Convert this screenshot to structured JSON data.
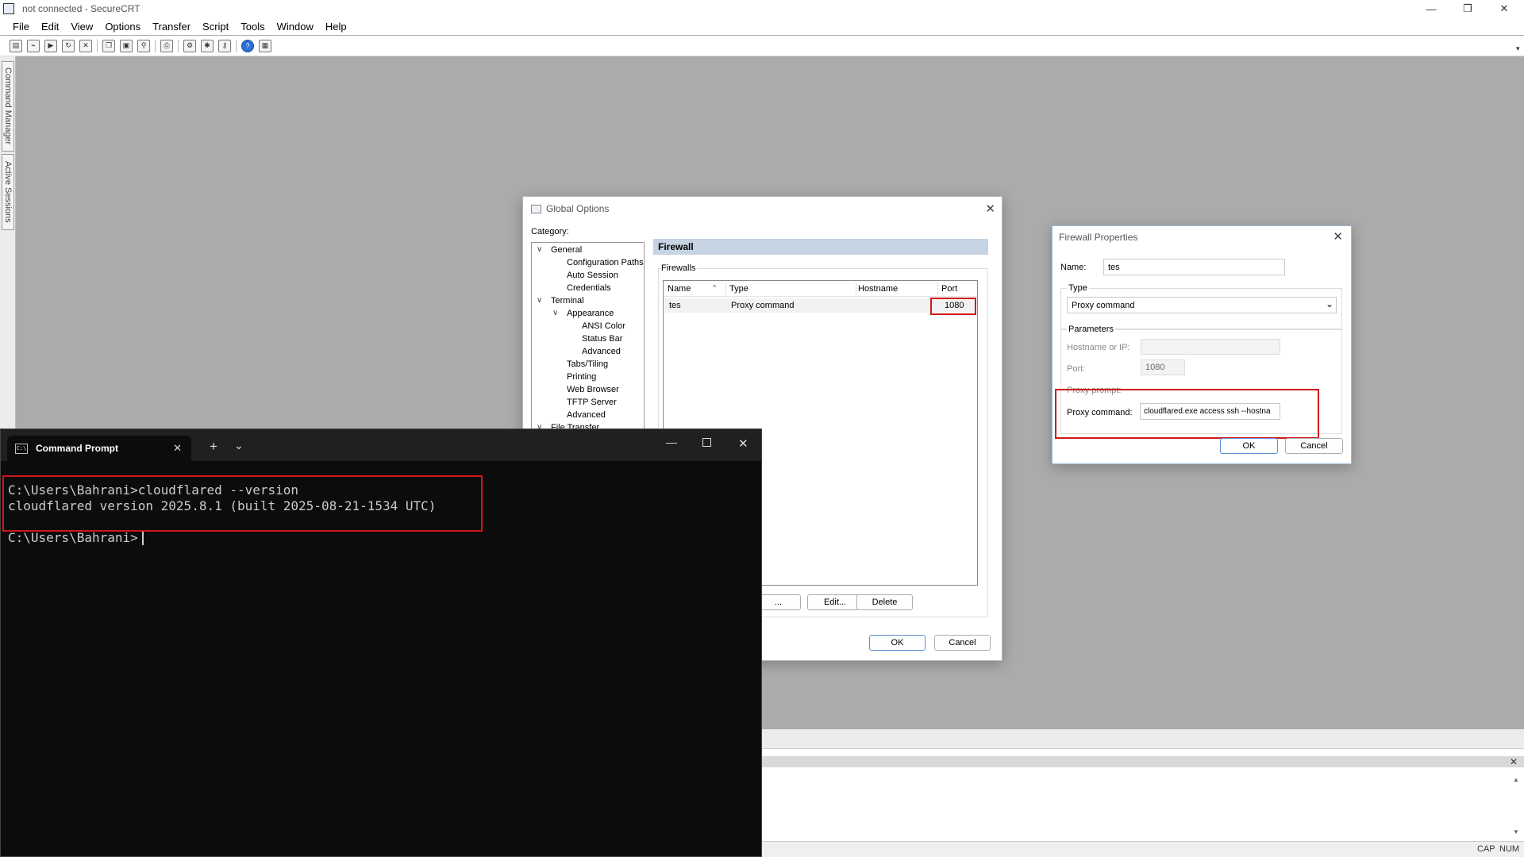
{
  "window": {
    "title": "not connected - SecureCRT",
    "controls": {
      "minimize": "—",
      "maximize": "❐",
      "close": "✕"
    }
  },
  "menu": [
    "File",
    "Edit",
    "View",
    "Options",
    "Transfer",
    "Script",
    "Tools",
    "Window",
    "Help"
  ],
  "side_tabs": [
    "Command Manager",
    "Active Sessions"
  ],
  "status_bar": {
    "cap": "CAP",
    "num": "NUM"
  },
  "global_options": {
    "title": "Global Options",
    "category_label": "Category:",
    "tree": {
      "general": "General",
      "configuration_paths": "Configuration Paths",
      "auto_session": "Auto Session",
      "credentials": "Credentials",
      "terminal": "Terminal",
      "appearance": "Appearance",
      "ansi_color": "ANSI Color",
      "status_bar": "Status Bar",
      "advanced_appearance": "Advanced",
      "tabs_tiling": "Tabs/Tiling",
      "printing": "Printing",
      "web_browser": "Web Browser",
      "tftp_server": "TFTP Server",
      "advanced_terminal": "Advanced",
      "file_transfer": "File Transfer"
    },
    "panel_title": "Firewall",
    "group_label": "Firewalls",
    "columns": {
      "name": "Name",
      "type": "Type",
      "hostname": "Hostname",
      "port": "Port"
    },
    "rows": [
      {
        "name": "tes",
        "type": "Proxy command",
        "hostname": "",
        "port": "1080"
      }
    ],
    "buttons": {
      "add": "...",
      "edit": "Edit...",
      "delete": "Delete",
      "ok": "OK",
      "cancel": "Cancel"
    }
  },
  "firewall_properties": {
    "title": "Firewall Properties",
    "name_label": "Name:",
    "name_value": "tes",
    "type_label": "Type",
    "type_value": "Proxy command",
    "parameters_label": "Parameters",
    "hostname_label": "Hostname or IP:",
    "hostname_value": "",
    "port_label": "Port:",
    "port_value": "1080",
    "proxy_prompt_label": "Proxy prompt:",
    "proxy_command_label": "Proxy command:",
    "proxy_command_value": "cloudflared.exe access ssh --hostna",
    "ok": "OK",
    "cancel": "Cancel"
  },
  "command_prompt": {
    "tab_title": "Command Prompt",
    "tab_icon": "C:\\",
    "new_tab": "+",
    "dropdown": "⌄",
    "lines": [
      "C:\\Users\\Bahrani>cloudflared --version",
      "cloudflared version 2025.8.1 (built 2025-08-21-1534 UTC)",
      "C:\\Users\\Bahrani>"
    ]
  }
}
